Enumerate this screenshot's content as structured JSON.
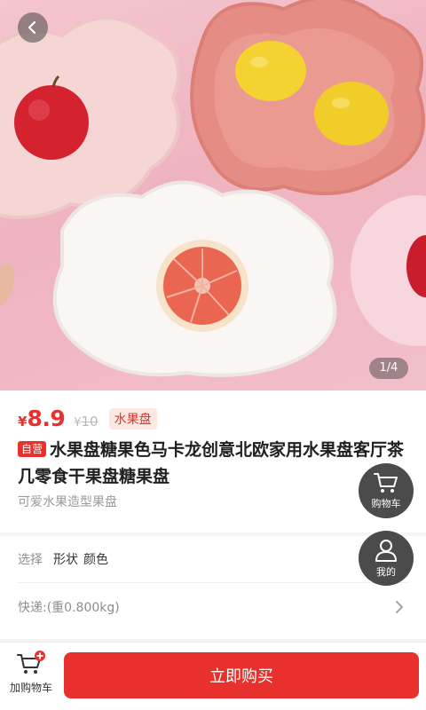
{
  "gallery": {
    "counter": "1/4"
  },
  "product": {
    "currency": "¥",
    "price": "8.9",
    "original_currency": "¥",
    "original_price": "10",
    "category_tag": "水果盘",
    "self_operated_tag": "自营",
    "title": "水果盘糖果色马卡龙创意北欧家用水果盘客厅茶几零食干果盘糖果盘",
    "subtitle": "可爱水果造型果盘"
  },
  "options": {
    "select_label": "选择",
    "select_value_1": "形状",
    "select_value_2": "颜色",
    "shipping_label": "快递:(重0.800kg)"
  },
  "floating": {
    "cart_label": "购物车",
    "mine_label": "我的"
  },
  "bottom": {
    "add_cart_label": "加购物车",
    "buy_label": "立即购买"
  },
  "colors": {
    "accent": "#e8302c",
    "tag_bg": "#fde8df"
  },
  "icons": [
    "back-icon",
    "cart-icon",
    "user-icon",
    "add-cart-icon",
    "chevron-right-icon"
  ]
}
